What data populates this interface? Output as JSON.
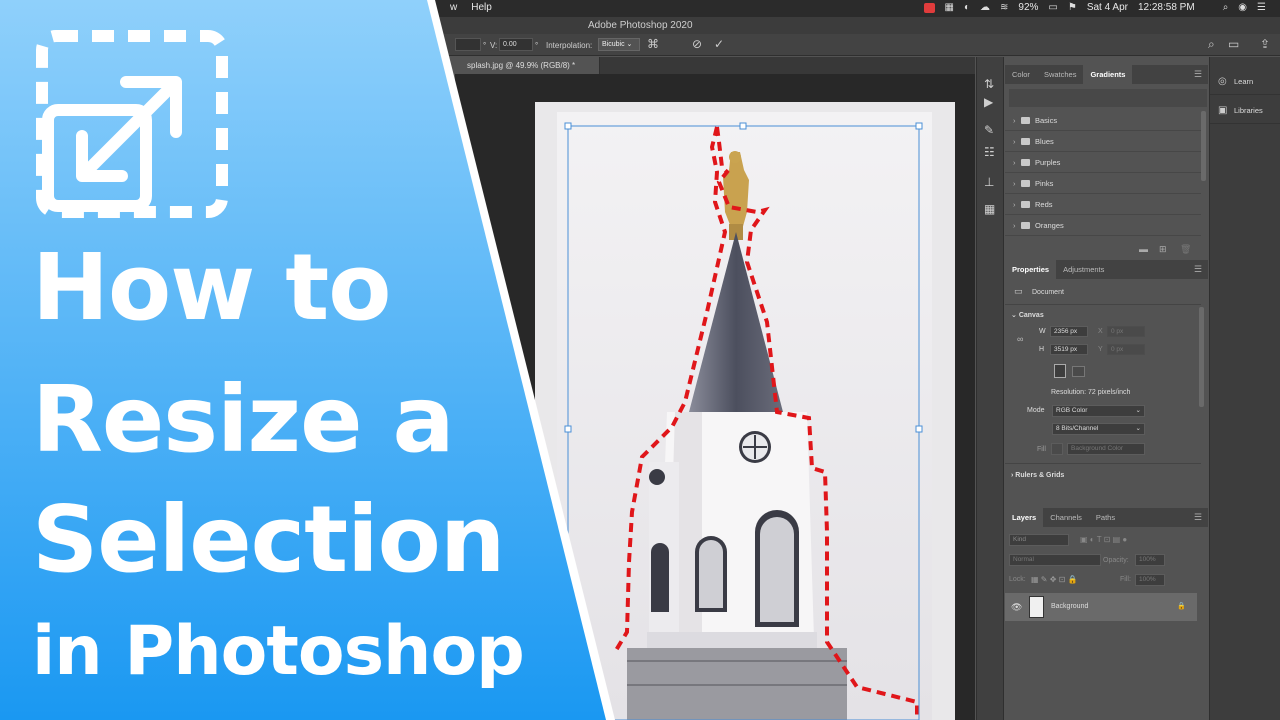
{
  "menubar": {
    "items": [
      "w",
      "Help"
    ],
    "date": "Sat 4 Apr",
    "time": "12:28:58 PM",
    "battery": "92%"
  },
  "window": {
    "title": "Adobe Photoshop 2020"
  },
  "options": {
    "v_label": "V:",
    "v_value": "0.00",
    "interp_label": "Interpolation:",
    "interp_value": "Bicubic",
    "cancel_icon": "cancel-icon",
    "commit_icon": "check-icon"
  },
  "document": {
    "tab": "splash.jpg @ 49.9% (RGB/8) *"
  },
  "gradients_panel": {
    "tabs": [
      "Color",
      "Swatches",
      "Gradients"
    ],
    "active": "Gradients",
    "folders": [
      "Basics",
      "Blues",
      "Purples",
      "Pinks",
      "Reds",
      "Oranges"
    ]
  },
  "properties_panel": {
    "tabs": [
      "Properties",
      "Adjustments"
    ],
    "doc_label": "Document",
    "canvas_label": "Canvas",
    "w_label": "W",
    "w_value": "2356 px",
    "h_label": "H",
    "h_value": "3519 px",
    "x_label": "X",
    "x_value": "0 px",
    "y_label": "Y",
    "y_value": "0 px",
    "resolution": "Resolution: 72 pixels/inch",
    "mode_label": "Mode",
    "mode_value": "RGB Color",
    "depth_value": "8 Bits/Channel",
    "fill_label": "Fill",
    "fill_value": "Background Color",
    "rulers_label": "Rulers & Grids"
  },
  "layers_panel": {
    "tabs": [
      "Layers",
      "Channels",
      "Paths"
    ],
    "kind": "Kind",
    "blend": "Normal",
    "opacity_label": "Opacity:",
    "opacity_value": "100%",
    "lock_label": "Lock:",
    "fill_label": "Fill:",
    "fill_value": "100%",
    "layer_name": "Background"
  },
  "side_panel": {
    "learn": "Learn",
    "libraries": "Libraries"
  },
  "overlay": {
    "line1": "How to",
    "line2": "Resize a",
    "line3": "Selection",
    "line4": "in Photoshop",
    "colors": {
      "top": "#8fd0fb",
      "bottom": "#1a98f2"
    }
  }
}
